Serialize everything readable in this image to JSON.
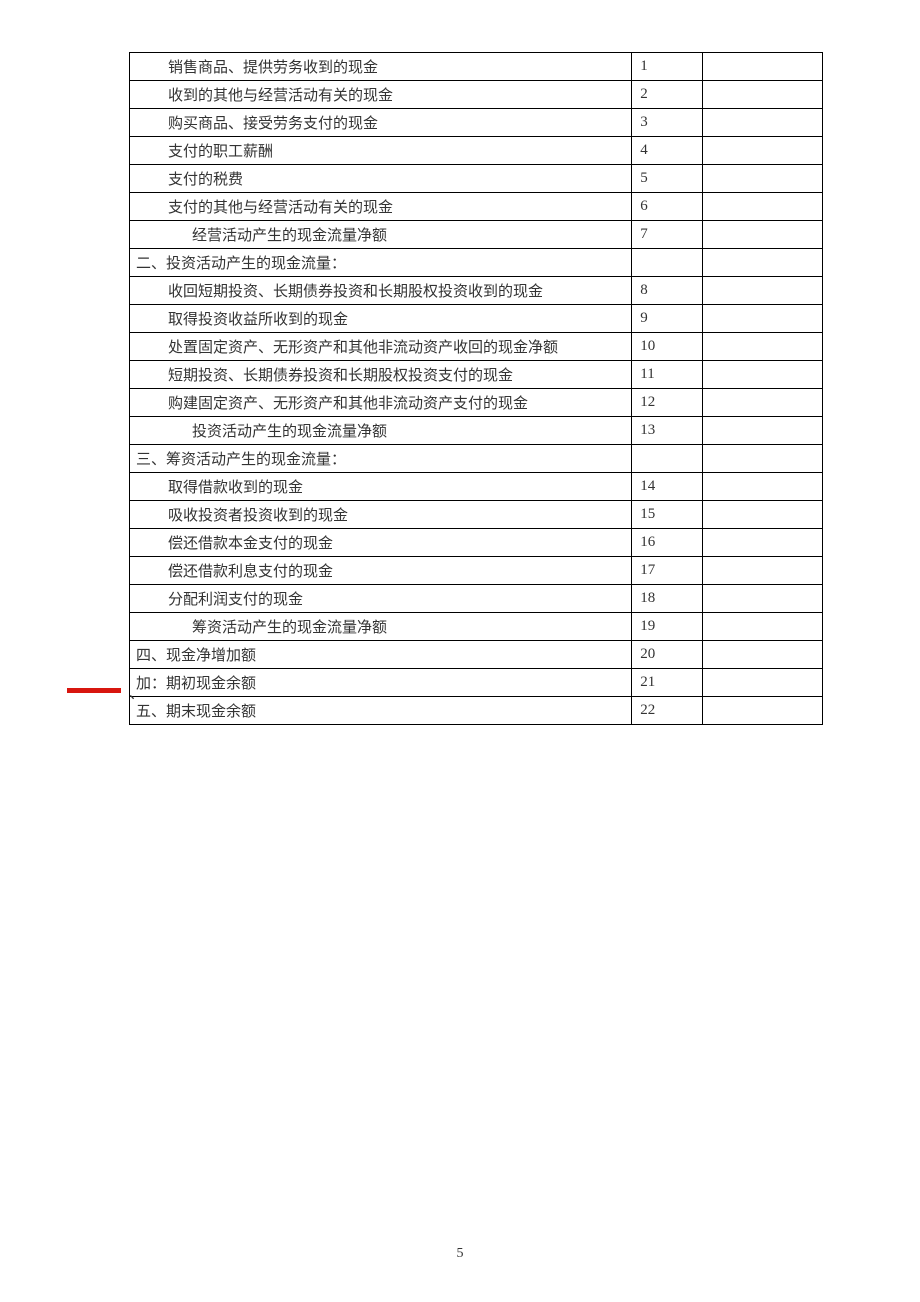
{
  "rows": [
    {
      "label": "销售商品、提供劳务收到的现金",
      "num": "1",
      "indent": 1
    },
    {
      "label": "收到的其他与经营活动有关的现金",
      "num": "2",
      "indent": 1
    },
    {
      "label": "购买商品、接受劳务支付的现金",
      "num": "3",
      "indent": 1
    },
    {
      "label": "支付的职工薪酬",
      "num": "4",
      "indent": 1
    },
    {
      "label": "支付的税费",
      "num": "5",
      "indent": 1
    },
    {
      "label": "支付的其他与经营活动有关的现金",
      "num": "6",
      "indent": 1
    },
    {
      "label": "经营活动产生的现金流量净额",
      "num": "7",
      "indent": 2
    },
    {
      "label": "二、投资活动产生的现金流量：",
      "num": "",
      "indent": 0
    },
    {
      "label": "收回短期投资、长期债券投资和长期股权投资收到的现金",
      "num": "8",
      "indent": 1
    },
    {
      "label": "取得投资收益所收到的现金",
      "num": "9",
      "indent": 1
    },
    {
      "label": "处置固定资产、无形资产和其他非流动资产收回的现金净额",
      "num": "10",
      "indent": 1
    },
    {
      "label": "短期投资、长期债券投资和长期股权投资支付的现金",
      "num": "11",
      "indent": 1
    },
    {
      "label": "购建固定资产、无形资产和其他非流动资产支付的现金",
      "num": "12",
      "indent": 1
    },
    {
      "label": "投资活动产生的现金流量净额",
      "num": "13",
      "indent": 2
    },
    {
      "label": "三、筹资活动产生的现金流量：",
      "num": "",
      "indent": 0
    },
    {
      "label": "取得借款收到的现金",
      "num": "14",
      "indent": 1
    },
    {
      "label": "吸收投资者投资收到的现金",
      "num": "15",
      "indent": 1
    },
    {
      "label": "偿还借款本金支付的现金",
      "num": "16",
      "indent": 1
    },
    {
      "label": "偿还借款利息支付的现金",
      "num": "17",
      "indent": 1
    },
    {
      "label": "分配利润支付的现金",
      "num": "18",
      "indent": 1
    },
    {
      "label": "筹资活动产生的现金流量净额",
      "num": "19",
      "indent": 2
    },
    {
      "label": "四、现金净增加额",
      "num": "20",
      "indent": 0
    },
    {
      "label": "加：期初现金余额",
      "num": "21",
      "indent": 0
    },
    {
      "label": "五、期末现金余额",
      "num": "22",
      "indent": 0
    }
  ],
  "footer_dot": "、",
  "page_number": "5"
}
